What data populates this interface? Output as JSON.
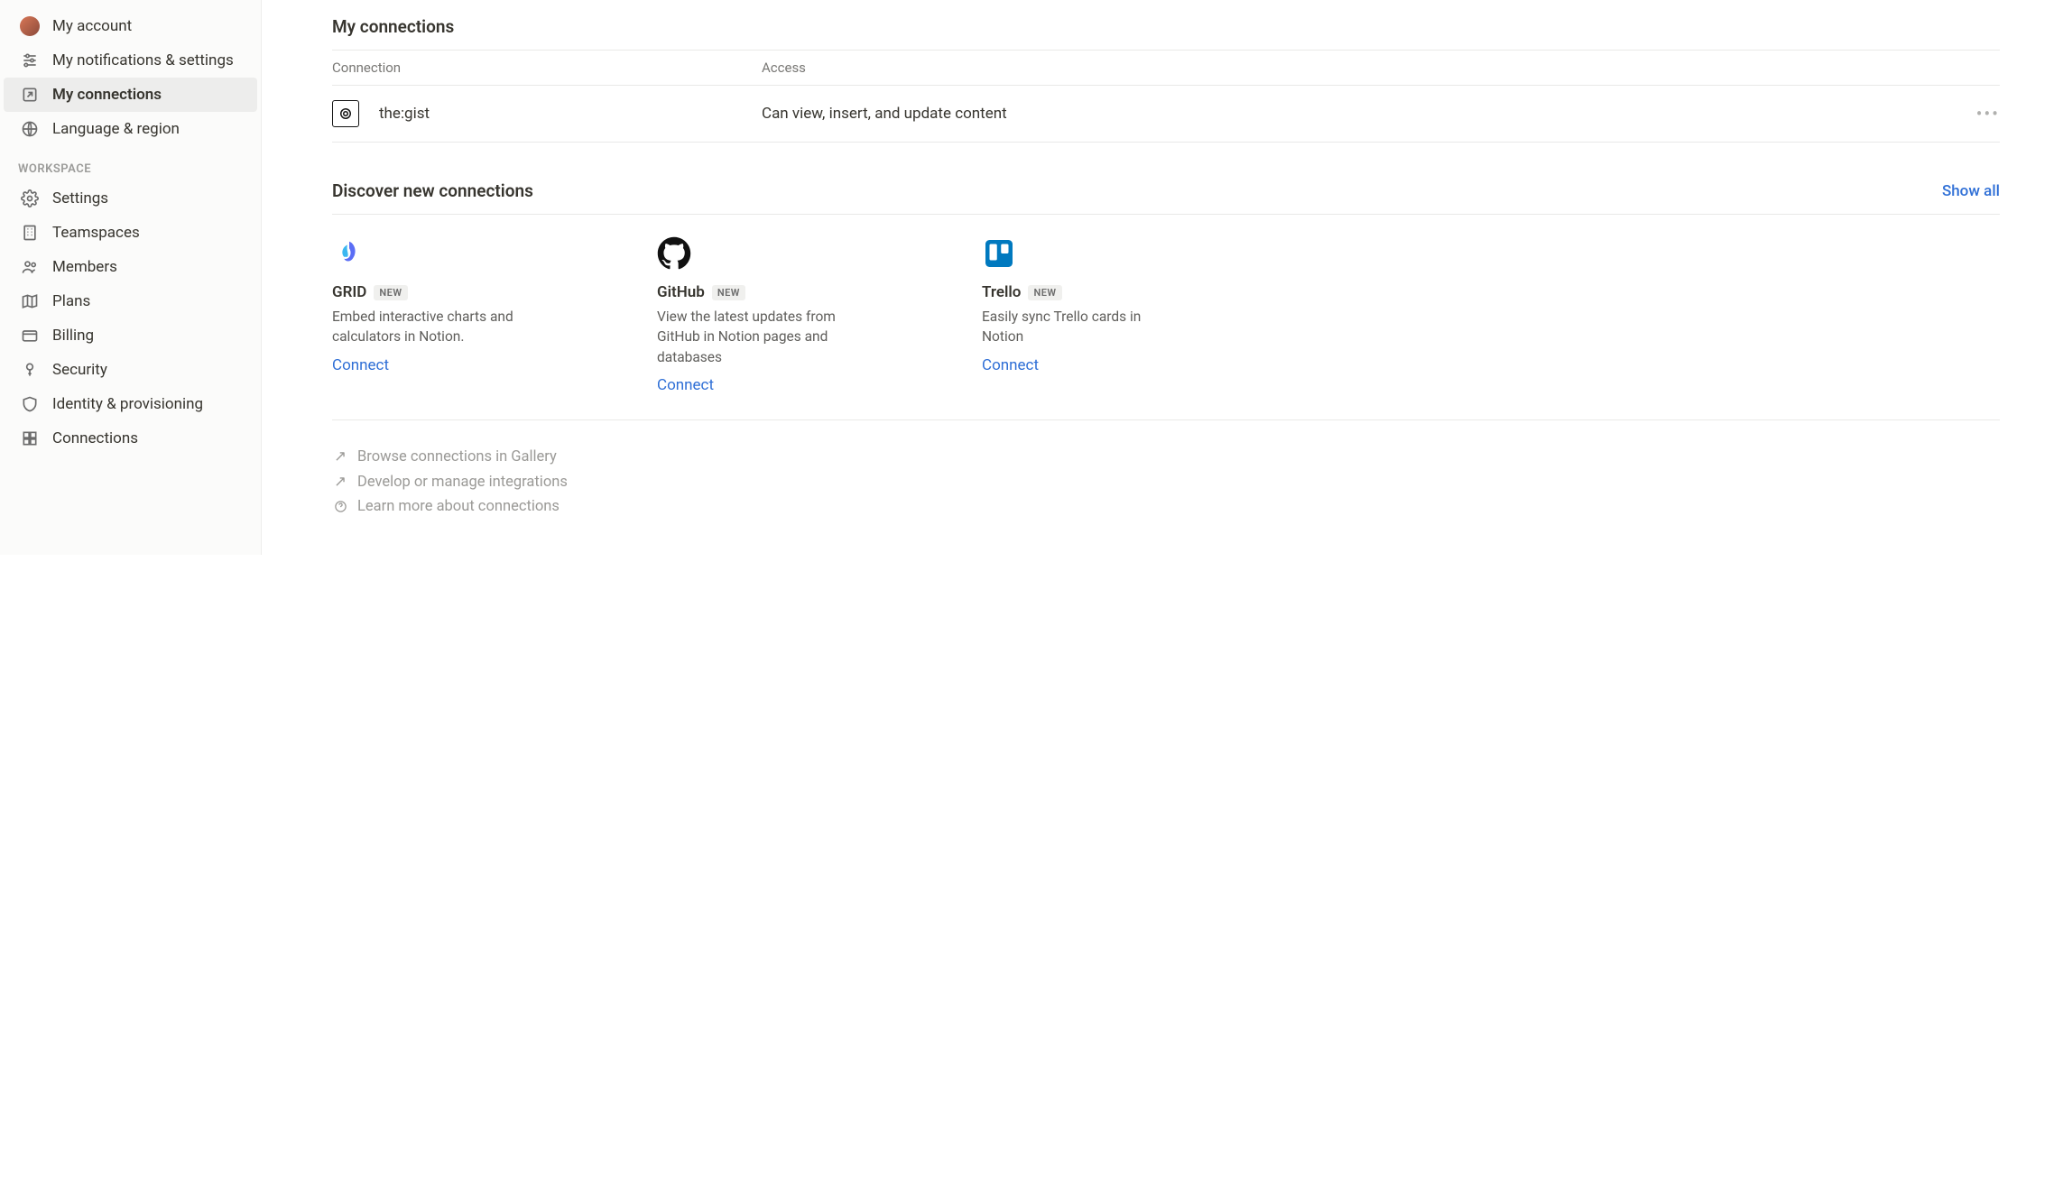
{
  "sidebar": {
    "account_items": [
      {
        "id": "my-account",
        "label": "My account",
        "icon": "avatar"
      },
      {
        "id": "my-notifications",
        "label": "My notifications & settings",
        "icon": "sliders"
      },
      {
        "id": "my-connections",
        "label": "My connections",
        "icon": "arrow-box",
        "active": true
      },
      {
        "id": "language-region",
        "label": "Language & region",
        "icon": "globe"
      }
    ],
    "workspace_label": "WORKSPACE",
    "workspace_items": [
      {
        "id": "settings",
        "label": "Settings",
        "icon": "gear"
      },
      {
        "id": "teamspaces",
        "label": "Teamspaces",
        "icon": "building"
      },
      {
        "id": "members",
        "label": "Members",
        "icon": "people"
      },
      {
        "id": "plans",
        "label": "Plans",
        "icon": "map"
      },
      {
        "id": "billing",
        "label": "Billing",
        "icon": "card"
      },
      {
        "id": "security",
        "label": "Security",
        "icon": "key"
      },
      {
        "id": "identity",
        "label": "Identity & provisioning",
        "icon": "shield"
      },
      {
        "id": "connections",
        "label": "Connections",
        "icon": "grid"
      }
    ]
  },
  "main": {
    "title": "My connections",
    "table": {
      "col_connection": "Connection",
      "col_access": "Access",
      "rows": [
        {
          "name": "the:gist",
          "access": "Can view, insert, and update content"
        }
      ]
    },
    "discover": {
      "title": "Discover new connections",
      "show_all": "Show all",
      "cards": [
        {
          "id": "grid",
          "name": "GRID",
          "badge": "NEW",
          "desc": "Embed interactive charts and calculators in Notion.",
          "cta": "Connect"
        },
        {
          "id": "github",
          "name": "GitHub",
          "badge": "NEW",
          "desc": "View the latest updates from GitHub in Notion pages and databases",
          "cta": "Connect"
        },
        {
          "id": "trello",
          "name": "Trello",
          "badge": "NEW",
          "desc": "Easily sync Trello cards in Notion",
          "cta": "Connect"
        }
      ]
    },
    "footer_links": [
      {
        "icon": "arrow-up-right",
        "label": "Browse connections in Gallery"
      },
      {
        "icon": "arrow-up-right",
        "label": "Develop or manage integrations"
      },
      {
        "icon": "question",
        "label": "Learn more about connections"
      }
    ]
  }
}
